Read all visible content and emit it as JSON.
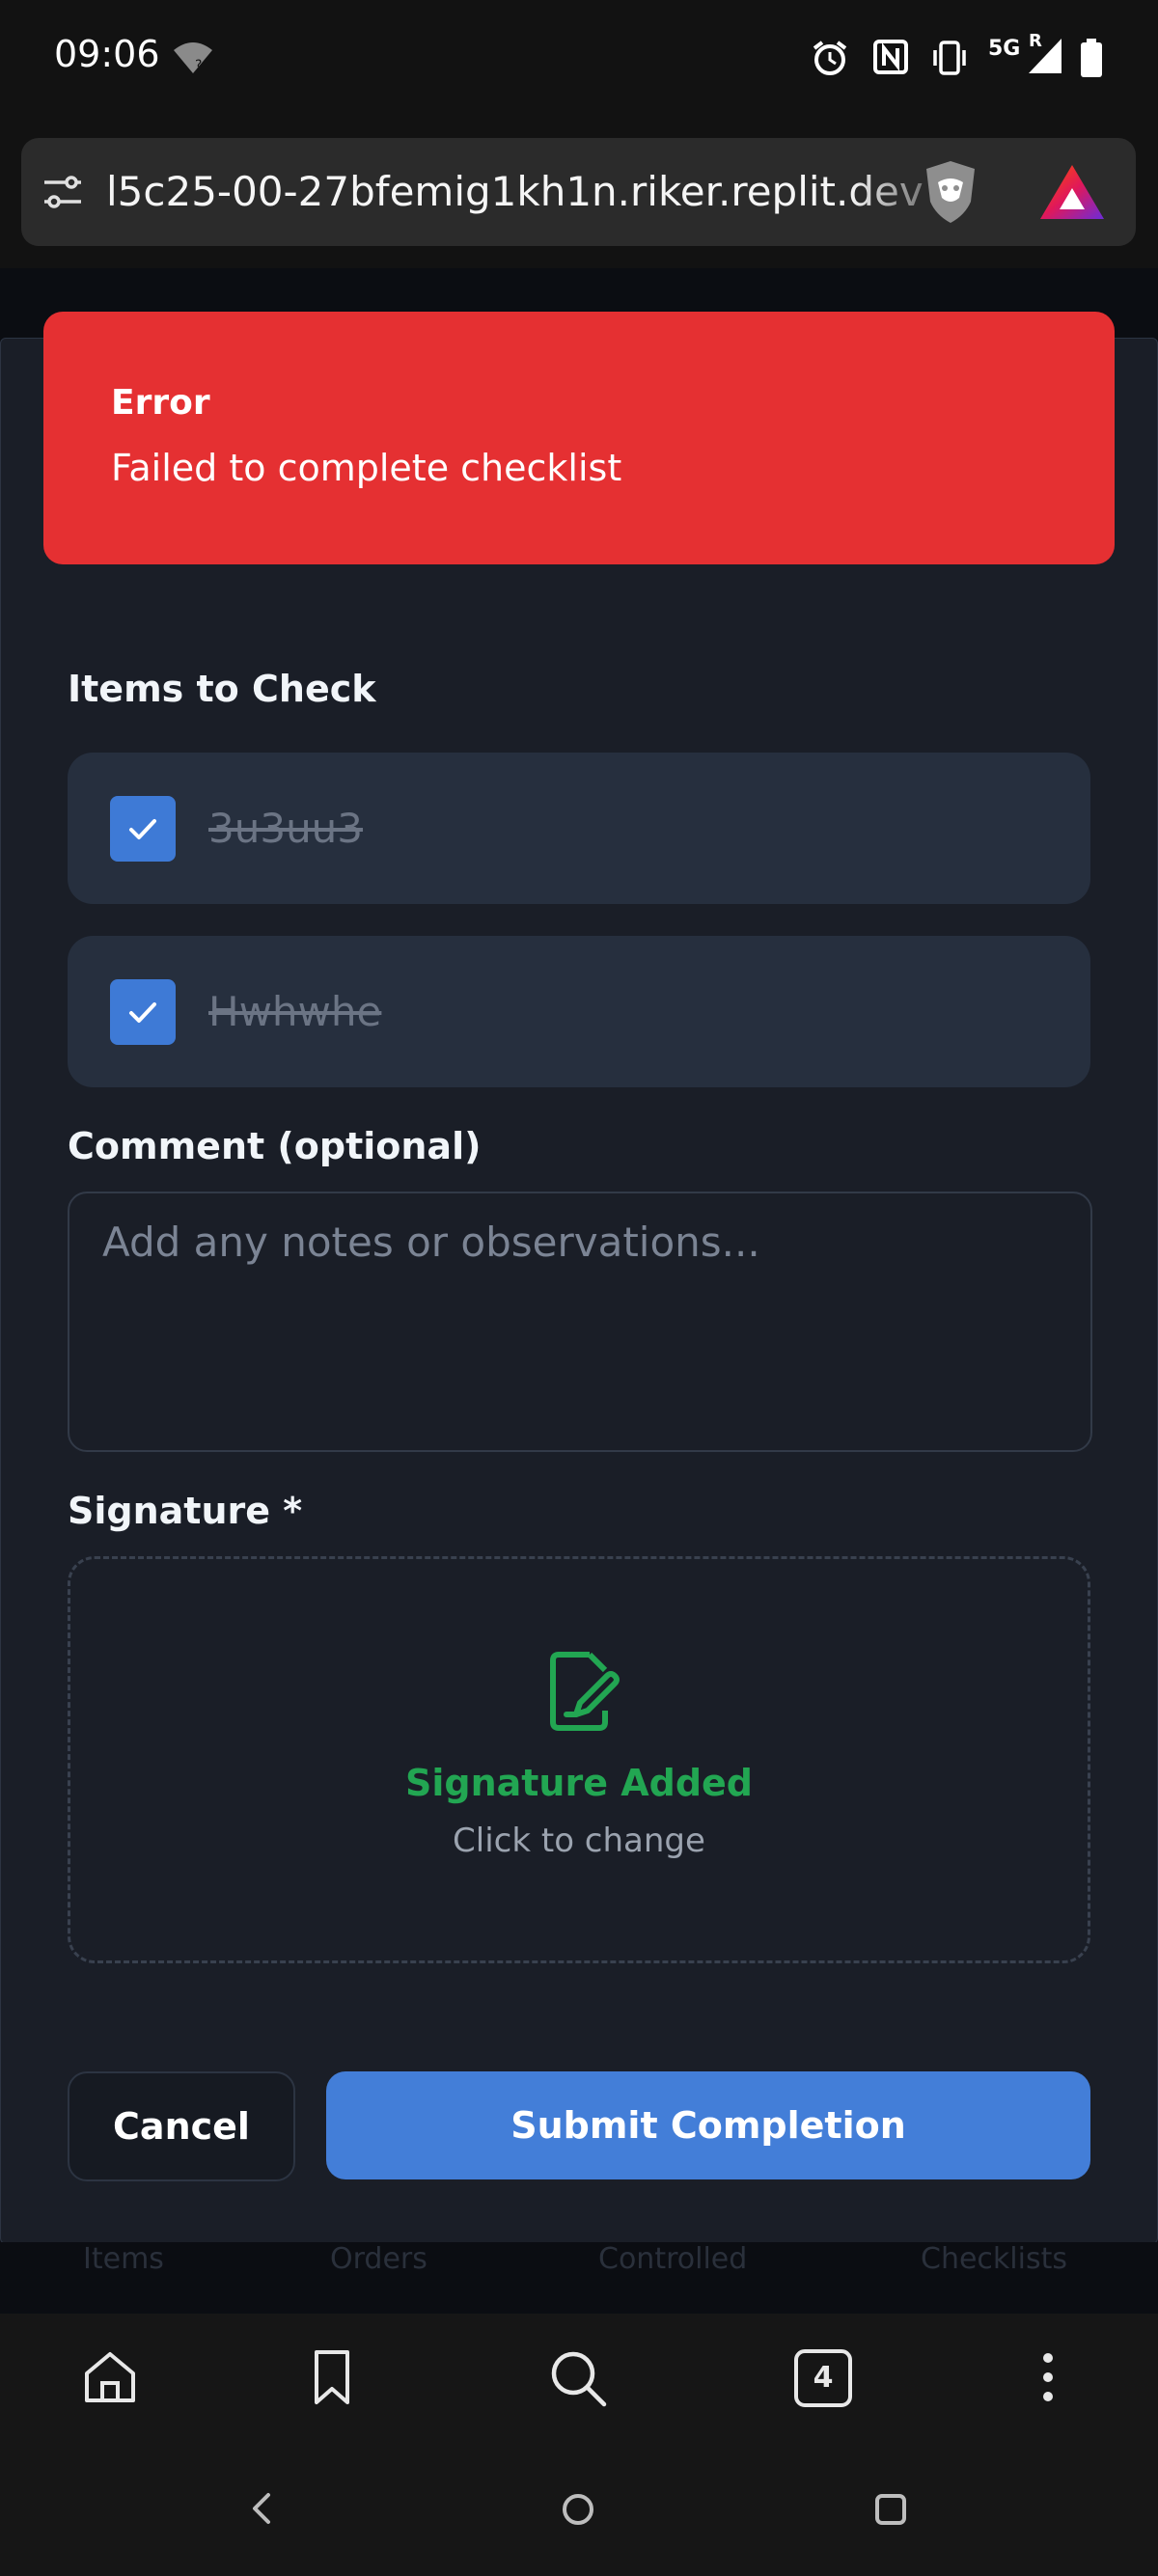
{
  "status_bar": {
    "time": "09:06",
    "network": "5G",
    "roaming": "R",
    "icons": [
      "wifi-icon",
      "alarm-icon",
      "nfc-icon",
      "vibrate-icon",
      "signal-icon",
      "battery-icon"
    ]
  },
  "browser": {
    "url": "l5c25-00-27bfemig1kh1n.riker.replit.dev",
    "icons": [
      "site-settings-icon",
      "brave-shield-icon",
      "brave-rewards-icon"
    ]
  },
  "toast": {
    "title": "Error",
    "message": "Failed to complete checklist"
  },
  "form": {
    "items_heading": "Items to Check",
    "items": [
      {
        "label": "3u3uu3",
        "checked": true
      },
      {
        "label": "Hwhwhe",
        "checked": true
      }
    ],
    "comment_label": "Comment (optional)",
    "comment_placeholder": "Add any notes or observations...",
    "comment_value": "",
    "signature_label": "Signature *",
    "signature_status": "Signature Added",
    "signature_hint": "Click to change",
    "cancel_label": "Cancel",
    "submit_label": "Submit Completion"
  },
  "behind_nav": {
    "labels": [
      "Items",
      "Orders",
      "Controlled",
      "Checklists"
    ]
  },
  "browser_bottom": {
    "tab_count": "4",
    "icons": [
      "home-icon",
      "bookmark-icon",
      "search-icon",
      "tabs-icon",
      "more-icon"
    ]
  },
  "colors": {
    "error": "#e53032",
    "accent": "#437ed8",
    "success": "#22a652",
    "surface": "#1a1e27",
    "item_bg": "#262f3e"
  }
}
